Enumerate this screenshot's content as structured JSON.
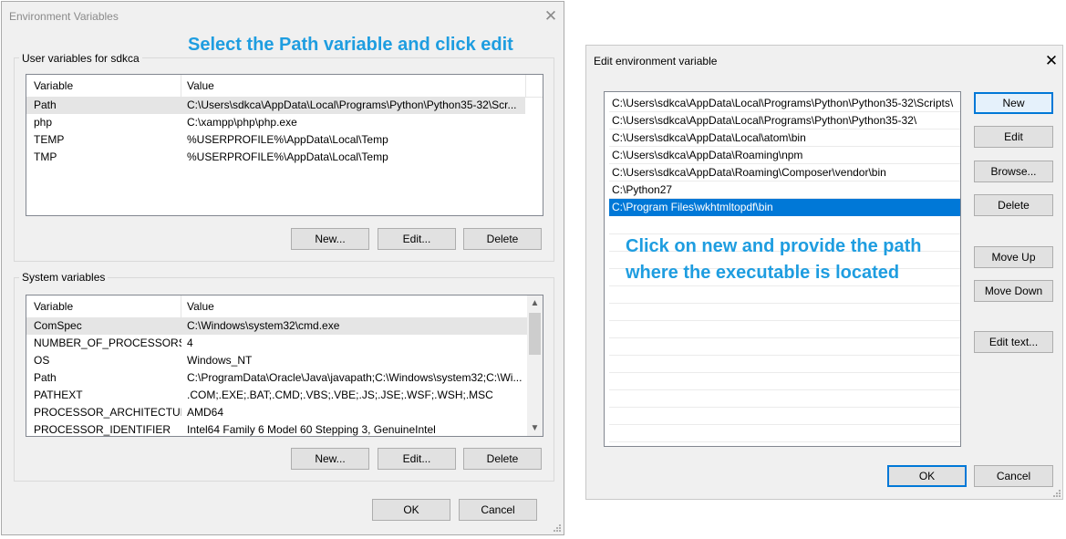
{
  "env_window": {
    "title": "Environment Variables",
    "annotation": "Select the Path variable and click edit",
    "user_group_label": "User variables for sdkca",
    "columns": [
      "Variable",
      "Value"
    ],
    "user_rows": [
      {
        "variable": "Path",
        "value": "C:\\Users\\sdkca\\AppData\\Local\\Programs\\Python\\Python35-32\\Scr...",
        "selected": true
      },
      {
        "variable": "php",
        "value": "C:\\xampp\\php\\php.exe",
        "selected": false
      },
      {
        "variable": "TEMP",
        "value": "%USERPROFILE%\\AppData\\Local\\Temp",
        "selected": false
      },
      {
        "variable": "TMP",
        "value": "%USERPROFILE%\\AppData\\Local\\Temp",
        "selected": false
      }
    ],
    "user_buttons": {
      "new": "New...",
      "edit": "Edit...",
      "delete": "Delete"
    },
    "system_group_label": "System variables",
    "system_rows": [
      {
        "variable": "ComSpec",
        "value": "C:\\Windows\\system32\\cmd.exe",
        "selected": true
      },
      {
        "variable": "NUMBER_OF_PROCESSORS",
        "value": "4",
        "selected": false
      },
      {
        "variable": "OS",
        "value": "Windows_NT",
        "selected": false
      },
      {
        "variable": "Path",
        "value": "C:\\ProgramData\\Oracle\\Java\\javapath;C:\\Windows\\system32;C:\\Wi...",
        "selected": false
      },
      {
        "variable": "PATHEXT",
        "value": ".COM;.EXE;.BAT;.CMD;.VBS;.VBE;.JS;.JSE;.WSF;.WSH;.MSC",
        "selected": false
      },
      {
        "variable": "PROCESSOR_ARCHITECTURE",
        "value": "AMD64",
        "selected": false
      },
      {
        "variable": "PROCESSOR_IDENTIFIER",
        "value": "Intel64 Family 6 Model 60 Stepping 3, GenuineIntel",
        "selected": false
      }
    ],
    "system_buttons": {
      "new": "New...",
      "edit": "Edit...",
      "delete": "Delete"
    },
    "ok_label": "OK",
    "cancel_label": "Cancel"
  },
  "edit_window": {
    "title": "Edit environment variable",
    "entries": [
      {
        "text": "C:\\Users\\sdkca\\AppData\\Local\\Programs\\Python\\Python35-32\\Scripts\\",
        "selected": false
      },
      {
        "text": "C:\\Users\\sdkca\\AppData\\Local\\Programs\\Python\\Python35-32\\",
        "selected": false
      },
      {
        "text": "C:\\Users\\sdkca\\AppData\\Local\\atom\\bin",
        "selected": false
      },
      {
        "text": "C:\\Users\\sdkca\\AppData\\Roaming\\npm",
        "selected": false
      },
      {
        "text": "C:\\Users\\sdkca\\AppData\\Roaming\\Composer\\vendor\\bin",
        "selected": false
      },
      {
        "text": "C:\\Python27",
        "selected": false
      },
      {
        "text": "C:\\Program Files\\wkhtmltopdf\\bin",
        "selected": true
      }
    ],
    "annotation_line1": "Click on new and provide the path",
    "annotation_line2": "where the executable is located",
    "buttons": {
      "new": "New",
      "edit": "Edit",
      "browse": "Browse...",
      "delete": "Delete",
      "move_up": "Move Up",
      "move_down": "Move Down",
      "edit_text": "Edit text..."
    },
    "ok_label": "OK",
    "cancel_label": "Cancel"
  },
  "icons": {
    "close": "close-icon",
    "scroll_up": "chevron-up-icon",
    "scroll_down": "chevron-down-icon",
    "resize_grip": "resize-grip-icon"
  },
  "colors": {
    "annotation": "#1e9de0",
    "selection_blue": "#0078d7",
    "selection_gray": "#e5e5e5",
    "window_bg": "#f0f0f0"
  }
}
